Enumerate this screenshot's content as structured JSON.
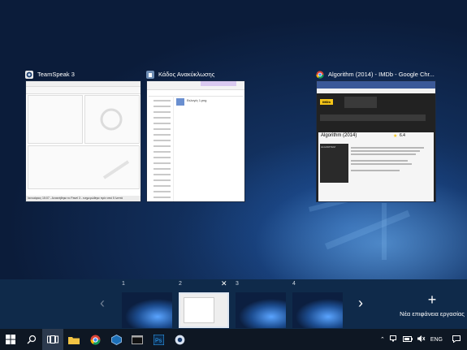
{
  "windows": [
    {
      "title": "TeamSpeak 3",
      "icon": "teamspeak-icon",
      "status_text": "Ιανουάριος 15:07 - Ανακτήθηκε το Pavel 3 - ενημερώθηκε πρίν από 5 λεπτά"
    },
    {
      "title": "Κάδος Ανακύκλωσης",
      "icon": "recycle-bin-icon",
      "file_name": "Εκλογές 1.png"
    },
    {
      "title": "Algorithm (2014) - IMDb - Google Chr...",
      "icon": "chrome-icon",
      "logo_text": "IMDb",
      "movie_title": "Algorithm (2014)",
      "rating": "6.4",
      "poster_text": "ALGORITHM"
    }
  ],
  "desktops": [
    {
      "number": "1"
    },
    {
      "number": "2"
    },
    {
      "number": "3"
    },
    {
      "number": "4"
    }
  ],
  "new_desktop_label": "Νέα επιφάνεια εργασίας",
  "new_desktop_glyph": "+",
  "close_glyph": "✕",
  "taskbar": {
    "items": [
      "windows-start-icon",
      "search-icon",
      "task-view-icon",
      "file-explorer-icon",
      "chrome-icon",
      "virtualbox-icon",
      "terminal-icon",
      "photoshop-icon",
      "teamspeak-icon"
    ],
    "language": "ENG"
  }
}
